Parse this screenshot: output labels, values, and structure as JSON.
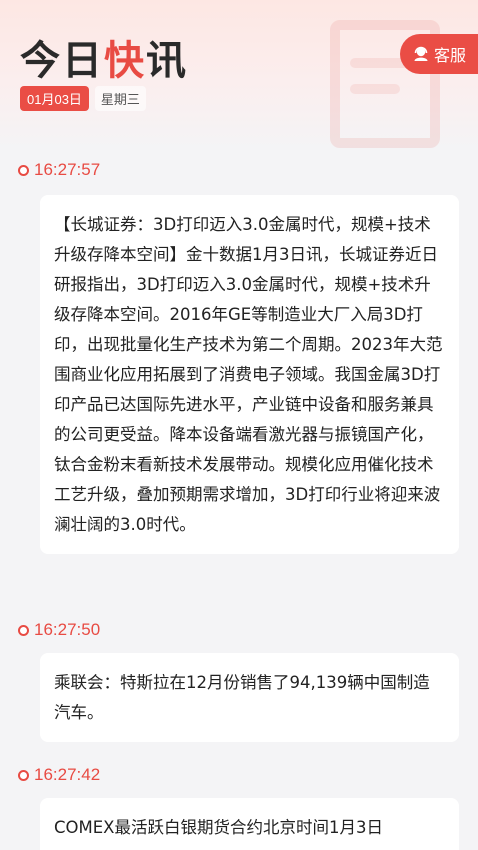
{
  "header": {
    "title_part1": "今日",
    "title_accent": "快",
    "title_part2": "讯",
    "date": "01月03日",
    "weekday": "星期三",
    "service_label": "客服"
  },
  "news": [
    {
      "time": "16:27:57",
      "content": "【长城证券：3D打印迈入3.0金属时代，规模+技术升级存降本空间】金十数据1月3日讯，长城证券近日研报指出，3D打印迈入3.0金属时代，规模+技术升级存降本空间。2016年GE等制造业大厂入局3D打印，出现批量化生产技术为第二个周期。2023年大范围商业化应用拓展到了消费电子领域。我国金属3D打印产品已达国际先进水平，产业链中设备和服务兼具的公司更受益。降本设备端看激光器与振镜国产化，钛合金粉末看新技术发展带动。规模化应用催化技术工艺升级，叠加预期需求增加，3D打印行业将迎来波澜壮阔的3.0时代。"
    },
    {
      "time": "16:27:50",
      "content": "乘联会：特斯拉在12月份销售了94,139辆中国制造汽车。"
    },
    {
      "time": "16:27:42",
      "content": "COMEX最活跃白银期货合约北京时间1月3日"
    }
  ]
}
